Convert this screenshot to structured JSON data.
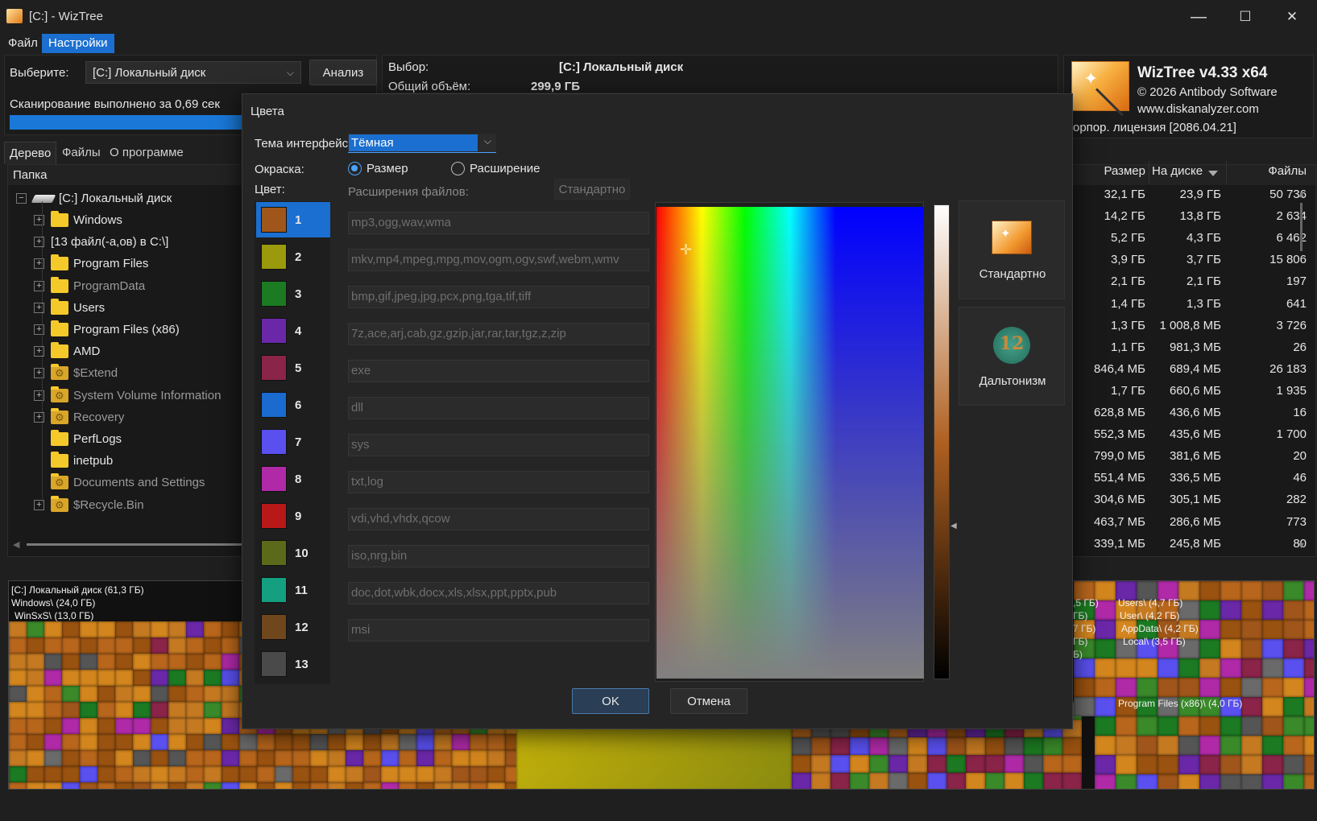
{
  "window": {
    "title": "[C:]  - WizTree",
    "minimize": "—",
    "maximize": "☐",
    "close": "✕"
  },
  "menu": {
    "file": "Файл",
    "settings": "Настройки"
  },
  "toolbar": {
    "select_label": "Выберите:",
    "drive_value": "[C:] Локальный диск",
    "analyze_button": "Анализ",
    "scan_status": "Сканирование выполнено за 0,69 сек",
    "scan_progress": 1.0,
    "selection_label": "Выбор:",
    "selection_value": "[C:]  Локальный диск",
    "total_label": "Общий объём:",
    "total_value": "299,9 ГБ"
  },
  "about": {
    "product": "WizTree v4.33 x64",
    "copyright": "© 2026 Antibody Software",
    "website": "www.diskanalyzer.com",
    "license": "орпор. лицензия [2086.04.21]"
  },
  "tabs": {
    "tree": "Дерево",
    "files": "Файлы",
    "about": "О программе"
  },
  "tree": {
    "column_folder": "Папка",
    "root": "[C:] Локальный диск",
    "items": [
      {
        "label": "Windows",
        "dim": false,
        "system": false,
        "expander": true
      },
      {
        "label": "[13 файл(-а,ов) в C:\\]",
        "dim": false,
        "system": false,
        "expander": true,
        "nofolder": true
      },
      {
        "label": "Program Files",
        "dim": false,
        "system": false,
        "expander": true
      },
      {
        "label": "ProgramData",
        "dim": true,
        "system": false,
        "expander": true
      },
      {
        "label": "Users",
        "dim": false,
        "system": false,
        "expander": true
      },
      {
        "label": "Program Files (x86)",
        "dim": false,
        "system": false,
        "expander": true
      },
      {
        "label": "AMD",
        "dim": false,
        "system": false,
        "expander": true
      },
      {
        "label": "$Extend",
        "dim": true,
        "system": true,
        "expander": true
      },
      {
        "label": "System Volume Information",
        "dim": true,
        "system": true,
        "expander": true
      },
      {
        "label": "Recovery",
        "dim": true,
        "system": true,
        "expander": true
      },
      {
        "label": "PerfLogs",
        "dim": false,
        "system": false,
        "expander": false
      },
      {
        "label": "inetpub",
        "dim": false,
        "system": false,
        "expander": false
      },
      {
        "label": "Documents and Settings",
        "dim": true,
        "system": true,
        "expander": false
      },
      {
        "label": "$Recycle.Bin",
        "dim": true,
        "system": true,
        "expander": true
      }
    ]
  },
  "table": {
    "headers": {
      "size": "Размер",
      "ondisk": "На диске",
      "files": "Файлы"
    },
    "rows": [
      [
        "32,1 ГБ",
        "23,9 ГБ",
        "50 736"
      ],
      [
        "14,2 ГБ",
        "13,8 ГБ",
        "2 634"
      ],
      [
        "5,2 ГБ",
        "4,3 ГБ",
        "6 462"
      ],
      [
        "3,9 ГБ",
        "3,7 ГБ",
        "15 806"
      ],
      [
        "2,1 ГБ",
        "2,1 ГБ",
        "197"
      ],
      [
        "1,4 ГБ",
        "1,3 ГБ",
        "641"
      ],
      [
        "1,3 ГБ",
        "1 008,8 МБ",
        "3 726"
      ],
      [
        "1,1 ГБ",
        "981,3 МБ",
        "26"
      ],
      [
        "846,4 МБ",
        "689,4 МБ",
        "26 183"
      ],
      [
        "1,7 ГБ",
        "660,6 МБ",
        "1 935"
      ],
      [
        "628,8 МБ",
        "436,6 МБ",
        "16"
      ],
      [
        "552,3 МБ",
        "435,6 МБ",
        "1 700"
      ],
      [
        "799,0 МБ",
        "381,6 МБ",
        "20"
      ],
      [
        "551,4 МБ",
        "336,5 МБ",
        "46"
      ],
      [
        "304,6 МБ",
        "305,1 МБ",
        "282"
      ],
      [
        "463,7 МБ",
        "286,6 МБ",
        "773"
      ],
      [
        "339,1 МБ",
        "245,8 МБ",
        "80"
      ]
    ]
  },
  "treemap": {
    "labels_left": [
      "[C:] Локальный диск (61,3 ГБ)",
      "Windows\\ (24,0 ГБ)",
      "WinSxS\\ (13,0 ГБ)"
    ],
    "labels_right": [
      "Users\\ (4,7 ГБ)",
      "User\\ (4,2 ГБ)",
      "AppData\\ (4,2 ГБ)",
      "Local\\ (3,5 ГБ)"
    ],
    "label_pf86": "Program Files (x86)\\ (4,0 ГБ)",
    "partial": [
      ",5 ГБ)",
      " ГБ)",
      "7 ГБ)",
      "ГБ)",
      "Б)"
    ]
  },
  "dialog": {
    "title": "Цвета",
    "theme_label": "Тема интерфейса",
    "theme_value": "Тёмная",
    "coloring_label": "Окраска:",
    "radio_size": "Размер",
    "radio_ext": "Расширение",
    "color_label": "Цвет:",
    "extensions_label": "Расширения файлов:",
    "standard_small": "Стандартно",
    "preset_standard": "Стандартно",
    "preset_colorblind": "Дальтонизм",
    "ok": "OK",
    "cancel": "Отмена",
    "colors": [
      {
        "num": "1",
        "hex": "#a0561a",
        "ext": "mp3,ogg,wav,wma"
      },
      {
        "num": "2",
        "hex": "#9a9a0c",
        "ext": "mkv,mp4,mpeg,mpg,mov,ogm,ogv,swf,webm,wmv"
      },
      {
        "num": "3",
        "hex": "#1c7a22",
        "ext": "bmp,gif,jpeg,jpg,pcx,png,tga,tif,tiff"
      },
      {
        "num": "4",
        "hex": "#6a28a8",
        "ext": "7z,ace,arj,cab,gz,gzip,jar,rar,tar,tgz,z,zip"
      },
      {
        "num": "5",
        "hex": "#8a2448",
        "ext": "exe"
      },
      {
        "num": "6",
        "hex": "#1a6ad0",
        "ext": "dll"
      },
      {
        "num": "7",
        "hex": "#5a50f0",
        "ext": "sys"
      },
      {
        "num": "8",
        "hex": "#b02aa8",
        "ext": "txt,log"
      },
      {
        "num": "9",
        "hex": "#b81818",
        "ext": "vdi,vhd,vhdx,qcow"
      },
      {
        "num": "10",
        "hex": "#5a6a1a",
        "ext": "iso,nrg,bin"
      },
      {
        "num": "11",
        "hex": "#14a080",
        "ext": "doc,dot,wbk,docx,xls,xlsx,ppt,pptx,pub"
      },
      {
        "num": "12",
        "hex": "#70461c",
        "ext": "msi"
      },
      {
        "num": "13",
        "hex": "#4a4a4a",
        "ext": ""
      }
    ]
  }
}
